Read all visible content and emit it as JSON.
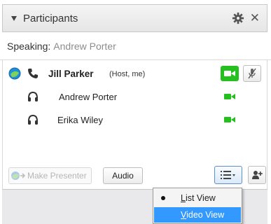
{
  "header": {
    "title": "Participants",
    "collapse_icon": "triangle-down-icon",
    "settings_icon": "gear-icon",
    "close_glyph": "✕"
  },
  "speaking": {
    "label": "Speaking:",
    "name": "Andrew Porter"
  },
  "participants": [
    {
      "name": "Jill Parker",
      "role": "(Host, me)",
      "bold": true,
      "icons": [
        "presenter-ball-icon",
        "phone-icon"
      ],
      "video": true,
      "mute": true
    },
    {
      "name": "Andrew Porter",
      "role": "",
      "bold": false,
      "icons": [
        "headset-icon"
      ],
      "video": true,
      "mute": false
    },
    {
      "name": "Erika Wiley",
      "role": "",
      "bold": false,
      "icons": [
        "headset-icon"
      ],
      "video": true,
      "mute": false
    }
  ],
  "toolbar": {
    "make_presenter_label": "Make Presenter",
    "audio_label": "Audio"
  },
  "view_menu": {
    "items": [
      {
        "label": "List View",
        "underline_char": "L",
        "rest": "ist View",
        "selected": true,
        "highlighted": false
      },
      {
        "label": "Video View",
        "underline_char": "V",
        "rest": "ideo View",
        "selected": false,
        "highlighted": true
      }
    ]
  },
  "colors": {
    "video_green": "#25c020",
    "highlight_blue": "#3399ff",
    "speaking_gray": "#8c8c8c"
  }
}
